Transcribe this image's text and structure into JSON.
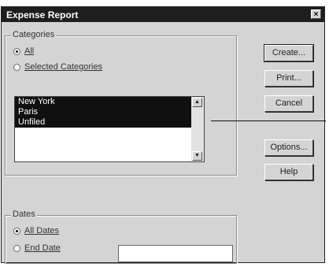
{
  "window": {
    "title": "Expense Report",
    "close_glyph": "×"
  },
  "categories": {
    "label": "Categories",
    "options": [
      {
        "label": "All",
        "selected": true
      },
      {
        "label": "Selected Categories",
        "selected": false
      }
    ],
    "list_items": [
      "New York",
      "Paris",
      "Unfiled"
    ]
  },
  "dates": {
    "label": "Dates",
    "options": [
      {
        "label": "All Dates",
        "selected": true
      },
      {
        "label": "End Date",
        "selected": false
      }
    ],
    "end_date_value": ""
  },
  "buttons": {
    "create": "Create...",
    "print": "Print...",
    "cancel": "Cancel",
    "options": "Options...",
    "help": "Help"
  }
}
